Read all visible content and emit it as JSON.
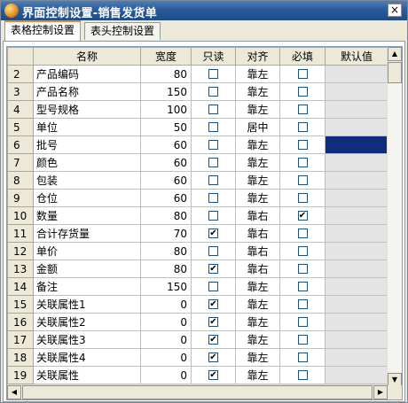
{
  "window": {
    "title": "界面控制设置-销售发货单",
    "close_glyph": "×"
  },
  "tabs": [
    {
      "label": "表格控制设置",
      "active": true
    },
    {
      "label": "表头控制设置",
      "active": false
    }
  ],
  "grid": {
    "columns": [
      "",
      "名称",
      "宽度",
      "只读",
      "对齐",
      "必填",
      "默认值"
    ],
    "rows": [
      {
        "idx": "2",
        "name": "产品编码",
        "width": "80",
        "readonly": false,
        "align": "靠左",
        "required": false,
        "default_selected": false
      },
      {
        "idx": "3",
        "name": "产品名称",
        "width": "150",
        "readonly": false,
        "align": "靠左",
        "required": false,
        "default_selected": false
      },
      {
        "idx": "4",
        "name": "型号规格",
        "width": "100",
        "readonly": false,
        "align": "靠左",
        "required": false,
        "default_selected": false
      },
      {
        "idx": "5",
        "name": "单位",
        "width": "50",
        "readonly": false,
        "align": "居中",
        "required": false,
        "default_selected": false
      },
      {
        "idx": "6",
        "name": "批号",
        "width": "60",
        "readonly": false,
        "align": "靠左",
        "required": false,
        "default_selected": true
      },
      {
        "idx": "7",
        "name": "颜色",
        "width": "60",
        "readonly": false,
        "align": "靠左",
        "required": false,
        "default_selected": false
      },
      {
        "idx": "8",
        "name": "包装",
        "width": "60",
        "readonly": false,
        "align": "靠左",
        "required": false,
        "default_selected": false
      },
      {
        "idx": "9",
        "name": "仓位",
        "width": "60",
        "readonly": false,
        "align": "靠左",
        "required": false,
        "default_selected": false
      },
      {
        "idx": "10",
        "name": "数量",
        "width": "80",
        "readonly": false,
        "align": "靠右",
        "required": true,
        "default_selected": false
      },
      {
        "idx": "11",
        "name": "合计存货量",
        "width": "70",
        "readonly": true,
        "align": "靠右",
        "required": false,
        "default_selected": false
      },
      {
        "idx": "12",
        "name": "单价",
        "width": "80",
        "readonly": false,
        "align": "靠右",
        "required": false,
        "default_selected": false
      },
      {
        "idx": "13",
        "name": "金额",
        "width": "80",
        "readonly": true,
        "align": "靠右",
        "required": false,
        "default_selected": false
      },
      {
        "idx": "14",
        "name": "备注",
        "width": "150",
        "readonly": false,
        "align": "靠左",
        "required": false,
        "default_selected": false
      },
      {
        "idx": "15",
        "name": "关联属性1",
        "width": "0",
        "readonly": true,
        "align": "靠左",
        "required": false,
        "default_selected": false
      },
      {
        "idx": "16",
        "name": "关联属性2",
        "width": "0",
        "readonly": true,
        "align": "靠左",
        "required": false,
        "default_selected": false
      },
      {
        "idx": "17",
        "name": "关联属性3",
        "width": "0",
        "readonly": true,
        "align": "靠左",
        "required": false,
        "default_selected": false
      },
      {
        "idx": "18",
        "name": "关联属性4",
        "width": "0",
        "readonly": true,
        "align": "靠左",
        "required": false,
        "default_selected": false
      },
      {
        "idx": "19",
        "name": "关联属性",
        "width": "0",
        "readonly": true,
        "align": "靠左",
        "required": false,
        "default_selected": false
      }
    ],
    "check_glyph": "✔",
    "selection_color": "#0f2d7a"
  },
  "scrollbars": {
    "up_glyph": "▲",
    "down_glyph": "▼",
    "left_glyph": "◀",
    "right_glyph": "▶"
  }
}
